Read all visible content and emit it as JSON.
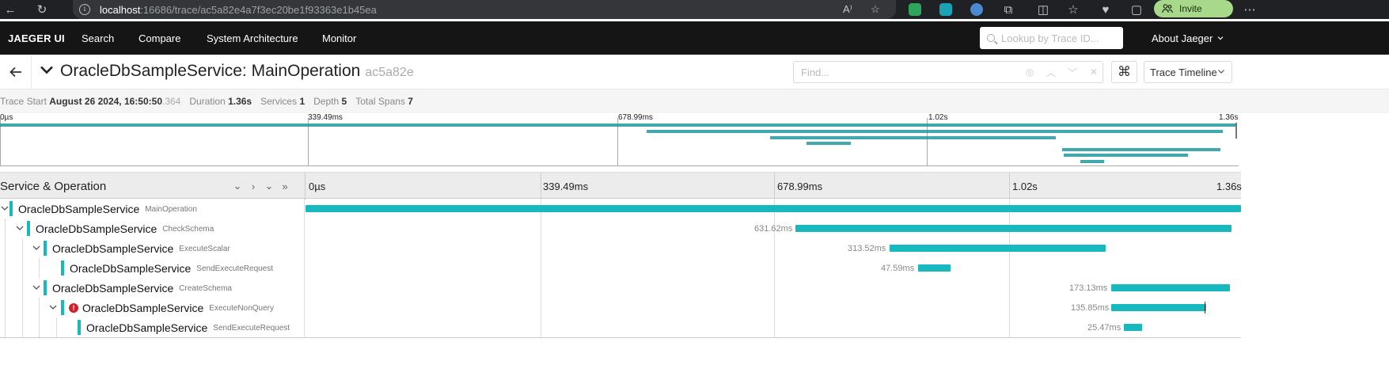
{
  "browser": {
    "address_host": "localhost",
    "address_path": ":16686/trace/ac5a82e4a7f3ec20be1f93363e1b45ea",
    "invite_label": "Invite"
  },
  "nav": {
    "brand": "JAEGER UI",
    "items": [
      "Search",
      "Compare",
      "System Architecture",
      "Monitor"
    ],
    "lookup_placeholder": "Lookup by Trace ID...",
    "about": "About Jaeger"
  },
  "trace": {
    "service_operation": "OracleDbSampleService: MainOperation",
    "trace_id_short": "ac5a82e",
    "find_placeholder": "Find...",
    "view_mode": "Trace Timeline"
  },
  "overview": {
    "trace_start_label": "Trace Start",
    "trace_start_value": "August 26 2024, 16:50:50",
    "trace_start_ms": ".364",
    "duration_label": "Duration",
    "duration_value": "1.36s",
    "services_label": "Services",
    "services_value": "1",
    "depth_label": "Depth",
    "depth_value": "5",
    "total_spans_label": "Total Spans",
    "total_spans_value": "7"
  },
  "ticks": [
    "0µs",
    "339.49ms",
    "678.99ms",
    "1.02s",
    "1.36s"
  ],
  "timeline_header": "Service & Operation",
  "spans": [
    {
      "service": "OracleDbSampleService",
      "operation": "MainOperation",
      "duration": "",
      "error": false
    },
    {
      "service": "OracleDbSampleService",
      "operation": "CheckSchema",
      "duration": "631.62ms",
      "error": false
    },
    {
      "service": "OracleDbSampleService",
      "operation": "ExecuteScalar",
      "duration": "313.52ms",
      "error": false
    },
    {
      "service": "OracleDbSampleService",
      "operation": "SendExecuteRequest",
      "duration": "47.59ms",
      "error": false
    },
    {
      "service": "OracleDbSampleService",
      "operation": "CreateSchema",
      "duration": "173.13ms",
      "error": false
    },
    {
      "service": "OracleDbSampleService",
      "operation": "ExecuteNonQuery",
      "duration": "135.85ms",
      "error": true
    },
    {
      "service": "OracleDbSampleService",
      "operation": "SendExecuteRequest",
      "duration": "25.47ms",
      "error": false
    }
  ],
  "colors": {
    "span": "#17b8be",
    "error": "#d21f2c",
    "nav_bg": "#151515"
  }
}
